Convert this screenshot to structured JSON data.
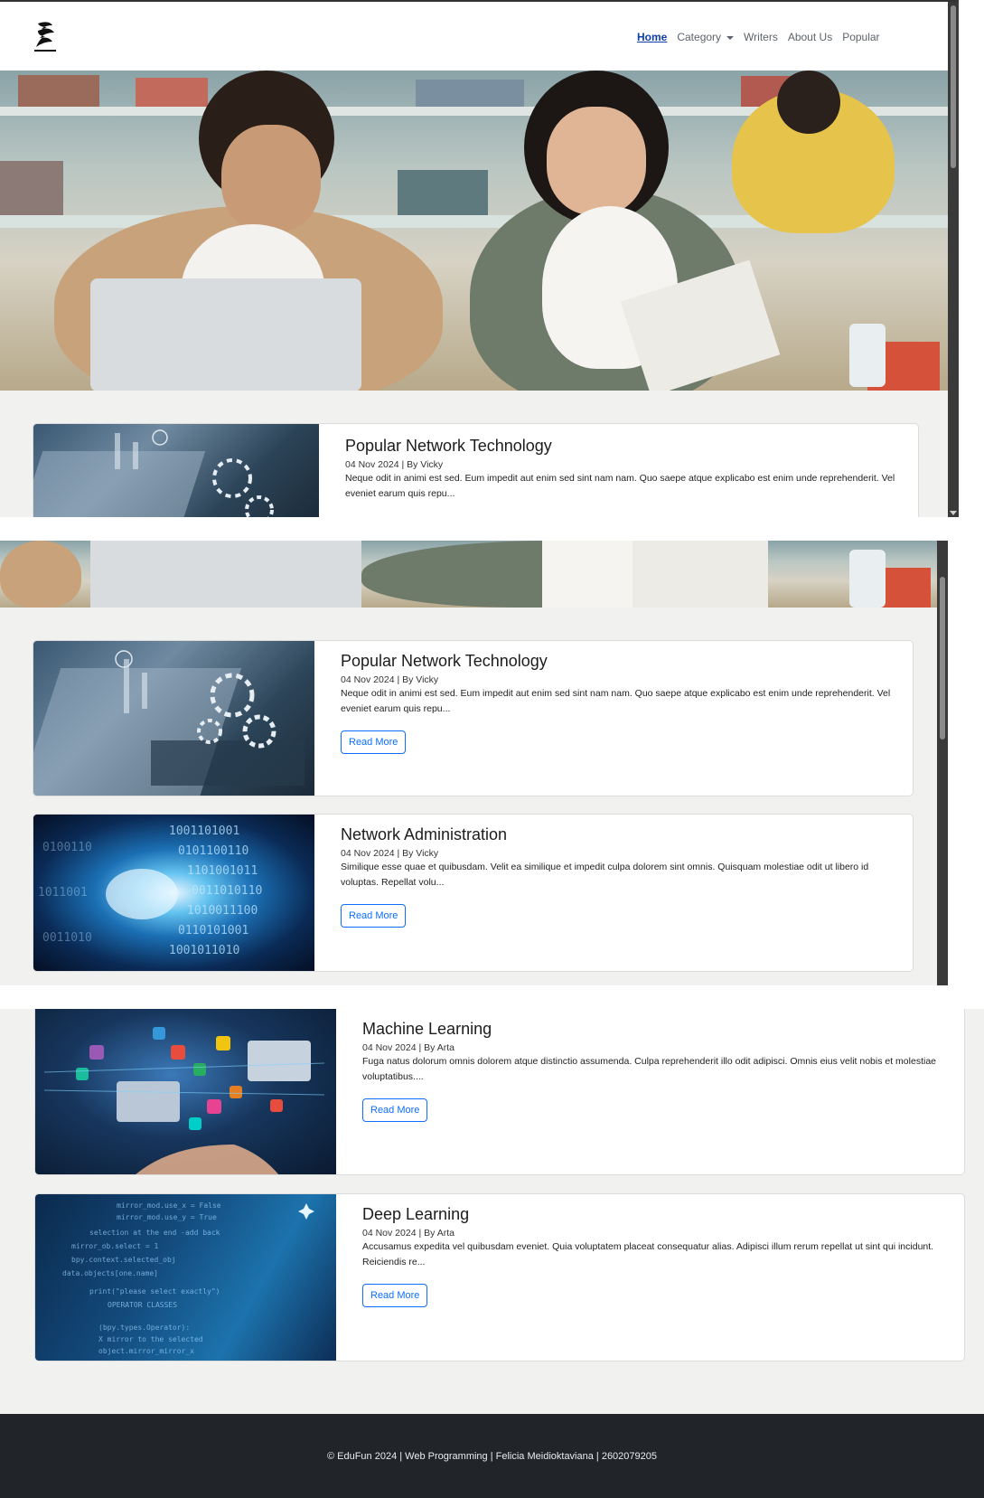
{
  "navbar": {
    "logo_alt": "EduFun logo",
    "links": [
      {
        "label": "Home",
        "active": true
      },
      {
        "label": "Category",
        "dropdown": true
      },
      {
        "label": "Writers"
      },
      {
        "label": "About Us"
      },
      {
        "label": "Popular"
      }
    ]
  },
  "articles": [
    {
      "title": "Popular Network Technology",
      "meta": "04 Nov 2024 | By Vicky",
      "excerpt": "Neque odit in animi est sed. Eum impedit aut enim sed sint nam nam. Quo saepe atque explicabo est enim unde reprehenderit. Vel eveniet earum quis repu...",
      "button": "Read More"
    },
    {
      "title": "Network Administration",
      "meta": "04 Nov 2024 | By Vicky",
      "excerpt": "Similique esse quae et quibusdam. Velit ea similique et impedit culpa dolorem sint omnis. Quisquam molestiae odit ut libero id voluptas. Repellat volu...",
      "button": "Read More"
    },
    {
      "title": "Machine Learning",
      "meta": "04 Nov 2024 | By Arta",
      "excerpt": "Fuga natus dolorum omnis dolorem atque distinctio assumenda. Culpa reprehenderit illo odit adipisci. Omnis eius velit nobis et molestiae voluptatibus....",
      "button": "Read More"
    },
    {
      "title": "Deep Learning",
      "meta": "04 Nov 2024 | By Arta",
      "excerpt": "Accusamus expedita vel quibusdam eveniet. Quia voluptatem placeat consequatur alias. Adipisci illum rerum repellat ut sint qui incidunt. Reiciendis re...",
      "button": "Read More"
    }
  ],
  "footer": {
    "text": "© EduFun 2024 | Web Programming | Felicia Meidioktaviana | 2602079205"
  }
}
